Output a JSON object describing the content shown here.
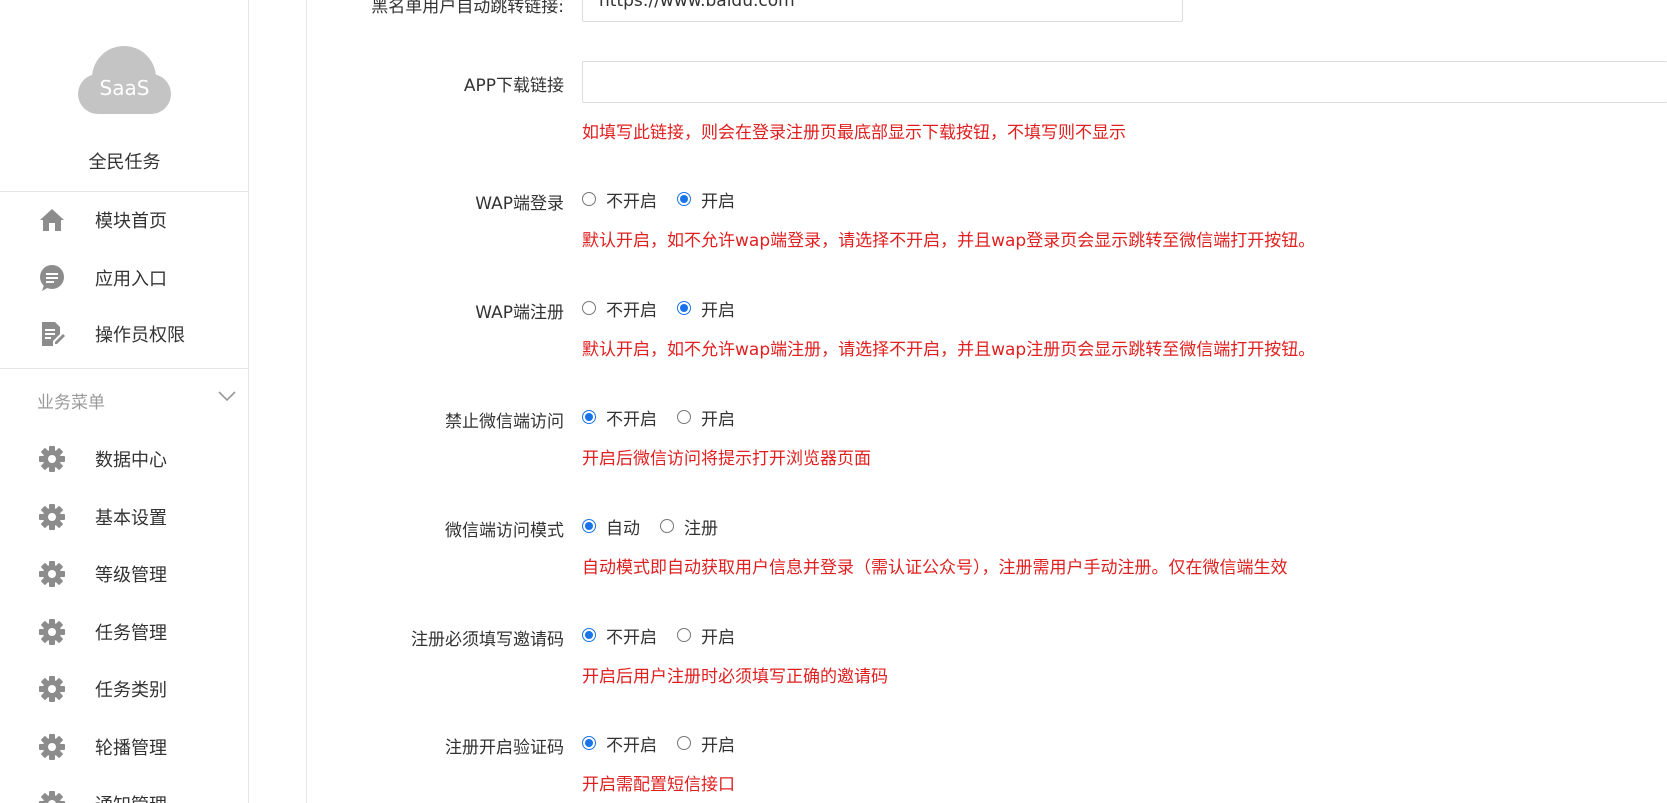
{
  "sidebar": {
    "logo_text": "SaaS",
    "app_name": "全民任务",
    "top_items": [
      {
        "label": "模块首页",
        "icon": "home-icon"
      },
      {
        "label": "应用入口",
        "icon": "chat-bubble-icon"
      },
      {
        "label": "操作员权限",
        "icon": "document-edit-icon"
      }
    ],
    "section": {
      "label": "业务菜单",
      "icon": "chevron-down-icon"
    },
    "business_items": [
      {
        "label": "数据中心",
        "icon": "gear-icon"
      },
      {
        "label": "基本设置",
        "icon": "gear-icon"
      },
      {
        "label": "等级管理",
        "icon": "gear-icon"
      },
      {
        "label": "任务管理",
        "icon": "gear-icon"
      },
      {
        "label": "任务类别",
        "icon": "gear-icon"
      },
      {
        "label": "轮播管理",
        "icon": "gear-icon"
      },
      {
        "label": "通知管理",
        "icon": "gear-icon"
      }
    ]
  },
  "form": {
    "blacklist_redirect": {
      "label": "黑名单用户自动跳转链接:",
      "value": "https://www.baidu.com"
    },
    "app_download": {
      "label": "APP下载链接",
      "value": "",
      "hint": "如填写此链接，则会在登录注册页最底部显示下载按钮，不填写则不显示"
    },
    "wap_login": {
      "label": "WAP端登录",
      "options": [
        "不开启",
        "开启"
      ],
      "selected": 1,
      "hint": "默认开启，如不允许wap端登录，请选择不开启，并且wap登录页会显示跳转至微信端打开按钮。"
    },
    "wap_register": {
      "label": "WAP端注册",
      "options": [
        "不开启",
        "开启"
      ],
      "selected": 1,
      "hint": "默认开启，如不允许wap端注册，请选择不开启，并且wap注册页会显示跳转至微信端打开按钮。"
    },
    "block_wechat": {
      "label": "禁止微信端访问",
      "options": [
        "不开启",
        "开启"
      ],
      "selected": 0,
      "hint": "开启后微信访问将提示打开浏览器页面"
    },
    "wechat_mode": {
      "label": "微信端访问模式",
      "options": [
        "自动",
        "注册"
      ],
      "selected": 0,
      "hint": "自动模式即自动获取用户信息并登录（需认证公众号），注册需用户手动注册。仅在微信端生效"
    },
    "invite_required": {
      "label": "注册必须填写邀请码",
      "options": [
        "不开启",
        "开启"
      ],
      "selected": 0,
      "hint": "开启后用户注册时必须填写正确的邀请码"
    },
    "register_captcha": {
      "label": "注册开启验证码",
      "options": [
        "不开启",
        "开启"
      ],
      "selected": 0,
      "hint": "开启需配置短信接口"
    }
  },
  "colors": {
    "accent": "#1a73e8",
    "hint": "#e02020",
    "logo_cloud": "#c4c4c4",
    "icon_gray": "#8c8c8c"
  }
}
